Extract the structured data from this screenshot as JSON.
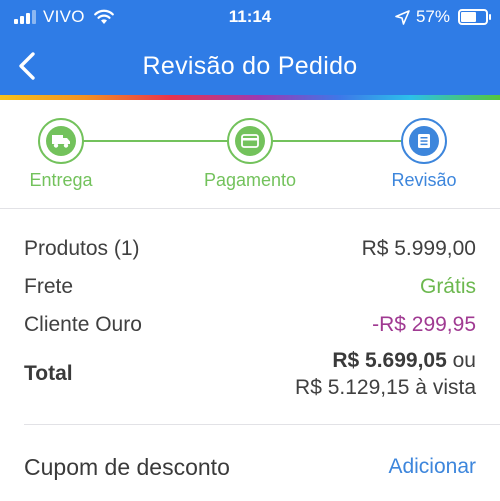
{
  "status_bar": {
    "carrier": "VIVO",
    "time": "11:14",
    "battery_text": "57%",
    "battery_level": 0.57,
    "icons": [
      "signal-icon",
      "wifi-icon",
      "location-arrow-icon",
      "battery-icon"
    ]
  },
  "nav": {
    "title": "Revisão do Pedido",
    "back_icon": "chevron-left-icon"
  },
  "colors": {
    "header": "#2f7ce6",
    "step_done": "#73c25c",
    "step_active": "#3d86dc",
    "free": "#6cb84f",
    "discount": "#a03a92",
    "link": "#3d86dc"
  },
  "steps": [
    {
      "label": "Entrega",
      "icon": "truck-icon",
      "state": "done"
    },
    {
      "label": "Pagamento",
      "icon": "credit-card-icon",
      "state": "done"
    },
    {
      "label": "Revisão",
      "icon": "list-icon",
      "state": "active"
    }
  ],
  "summary": {
    "products_label": "Produtos (1)",
    "products_value": "R$ 5.999,00",
    "shipping_label": "Frete",
    "shipping_value": "Grátis",
    "gold_label": "Cliente Ouro",
    "gold_value": "-R$ 299,95",
    "total_label": "Total",
    "total_value": "R$ 5.699,05",
    "total_or": " ou",
    "total_cash": "R$ 5.129,15 à vista"
  },
  "coupon": {
    "label": "Cupom de desconto",
    "action": "Adicionar"
  }
}
